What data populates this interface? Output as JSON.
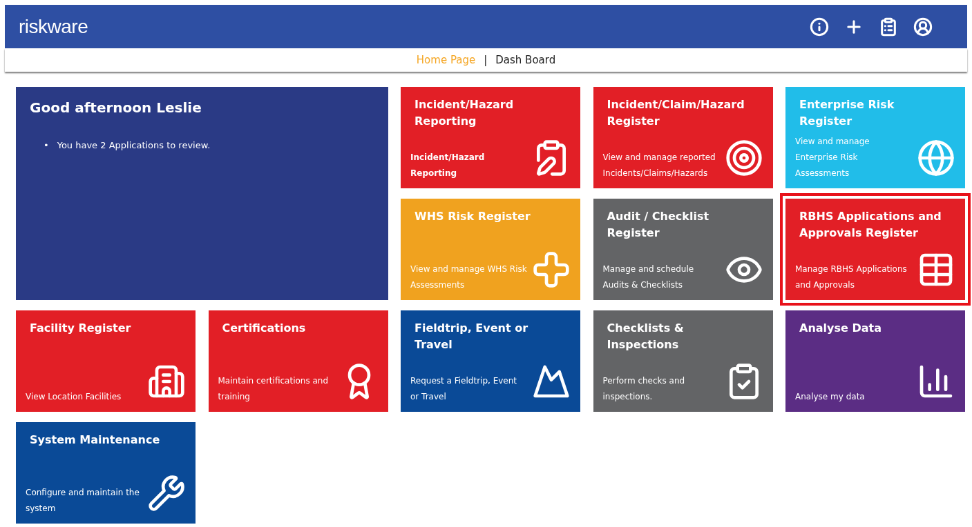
{
  "header": {
    "logo": "riskware"
  },
  "nav": [
    {
      "label": "Home Page",
      "selected": true
    },
    {
      "label": "Dash Board",
      "selected": false
    }
  ],
  "nav_separator": "|",
  "welcome": {
    "title": "Good afternoon Leslie",
    "bullet": "•",
    "items": [
      "You have 2 Applications to review."
    ]
  },
  "tiles": [
    {
      "title": "Incident/Hazard Reporting",
      "description": "Incident/Hazard Reporting",
      "color": "#e21f26",
      "bold_description": true,
      "highlighted": false
    },
    {
      "title": "Incident/Claim/Hazard Register",
      "description": "View and manage reported Incidents/Claims/Hazards",
      "color": "#e21f26",
      "bold_description": false,
      "highlighted": false
    },
    {
      "title": "Enterprise Risk Register",
      "description": "View and manage Enterprise Risk Assessments",
      "color": "#21bde9",
      "bold_description": false,
      "highlighted": false
    },
    {
      "title": "WHS Risk Register",
      "description": "View and manage WHS Risk Assessments",
      "color": "#f0a21f",
      "bold_description": false,
      "highlighted": false
    },
    {
      "title": "Audit / Checklist Register",
      "description": "Manage and schedule Audits & Checklists",
      "color": "#636466",
      "bold_description": false,
      "highlighted": false
    },
    {
      "title": "RBHS Applications and Approvals Register",
      "description": "Manage RBHS Applications and Approvals",
      "color": "#e21f26",
      "bold_description": false,
      "highlighted": true
    },
    {
      "title": "Facility Register",
      "description": "View Location Facilities",
      "color": "#e21f26",
      "bold_description": false,
      "highlighted": false
    },
    {
      "title": "Certifications",
      "description": "Maintain certifications and training",
      "color": "#e21f26",
      "bold_description": false,
      "highlighted": false
    },
    {
      "title": "Fieldtrip, Event or Travel",
      "description": "Request a Fieldtrip, Event or Travel",
      "color": "#0a4a97",
      "bold_description": false,
      "highlighted": false
    },
    {
      "title": "Checklists & Inspections",
      "description": "Perform checks and inspections.",
      "color": "#636466",
      "bold_description": false,
      "highlighted": false
    },
    {
      "title": "Analyse Data",
      "description": "Analyse my data",
      "color": "#5b2d84",
      "bold_description": false,
      "highlighted": false
    },
    {
      "title": "System Maintenance",
      "description": "Configure and maintain the system",
      "color": "#0a4a97",
      "bold_description": false,
      "highlighted": false
    }
  ]
}
